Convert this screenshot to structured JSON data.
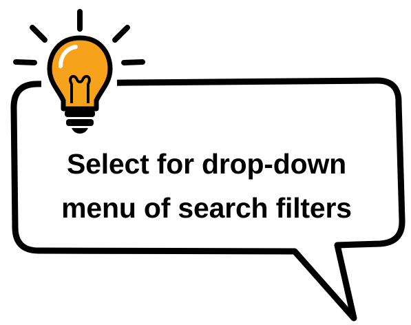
{
  "callout": {
    "lines": [
      "Select for drop-down",
      "menu of search filters"
    ]
  },
  "icons": {
    "lightbulb": "lightbulb-icon"
  },
  "colors": {
    "bulb_fill": "#F7A21B",
    "bulb_highlight": "#FFFFFF",
    "outline": "#000000",
    "background": "#FFFFFF"
  }
}
